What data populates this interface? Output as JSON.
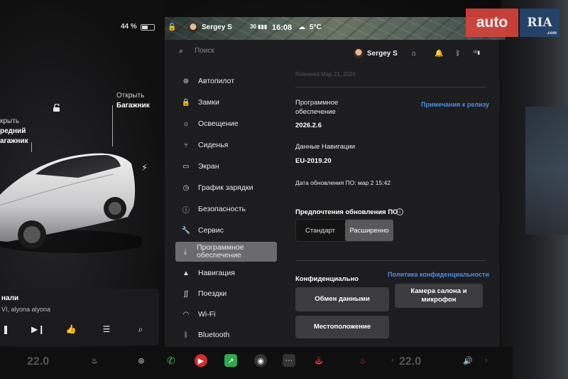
{
  "status": {
    "battery": "44 %",
    "user": "Sergey S",
    "temp_outside": "5°C",
    "time": "16:08"
  },
  "car": {
    "trunk_rear_line1": "Открыть",
    "trunk_rear_line2": "Багажник",
    "trunk_front_line1": "крыть",
    "trunk_front_line2": "редний",
    "trunk_front_line3": "агажник"
  },
  "media": {
    "title": "нали",
    "artist": "VI, alyona alyona"
  },
  "settings": {
    "search_placeholder": "Поиск",
    "profile_name": "Sergey S",
    "menu": [
      {
        "label": "Автопилот",
        "icon": "steering-wheel-icon"
      },
      {
        "label": "Замки",
        "icon": "lock-icon"
      },
      {
        "label": "Освещение",
        "icon": "sun-icon"
      },
      {
        "label": "Сиденья",
        "icon": "seat-icon"
      },
      {
        "label": "Экран",
        "icon": "display-icon"
      },
      {
        "label": "График зарядки",
        "icon": "clock-icon"
      },
      {
        "label": "Безопасность",
        "icon": "info-circle-icon"
      },
      {
        "label": "Сервис",
        "icon": "wrench-icon"
      },
      {
        "label": "Программное обеспечение",
        "icon": "download-icon",
        "active": true
      },
      {
        "label": "Навигация",
        "icon": "navigation-icon"
      },
      {
        "label": "Поездки",
        "icon": "trips-icon"
      },
      {
        "label": "Wi-Fi",
        "icon": "wifi-icon"
      },
      {
        "label": "Bluetooth",
        "icon": "bluetooth-icon"
      }
    ],
    "content": {
      "faded_top": "Released Мар 21, 2026",
      "software_label": "Программное обеспечение",
      "release_notes": "Примечания к релизу",
      "version": "2026.2.6",
      "nav_data_label": "Данные Навигации",
      "nav_data_version": "EU-2019.20",
      "update_date": "Дата обновления ПО: мар 2 15:42",
      "update_pref_label": "Предпочтения обновления ПО",
      "pref_options": [
        "Стандарт",
        "Расширенно"
      ],
      "pref_selected": "Расширенно",
      "privacy_label": "Конфиденциально",
      "privacy_policy": "Политика конфиденциальности",
      "btn_data_sharing": "Обмен данными",
      "btn_cabin_camera": "Камера салона и микрофон",
      "btn_location": "Местоположение"
    }
  },
  "dock": {
    "temp_left": "22.0",
    "temp_right": "22.0"
  },
  "watermark": {
    "auto": "auto",
    "ria": "RIA",
    "ria_sub": ".com"
  }
}
